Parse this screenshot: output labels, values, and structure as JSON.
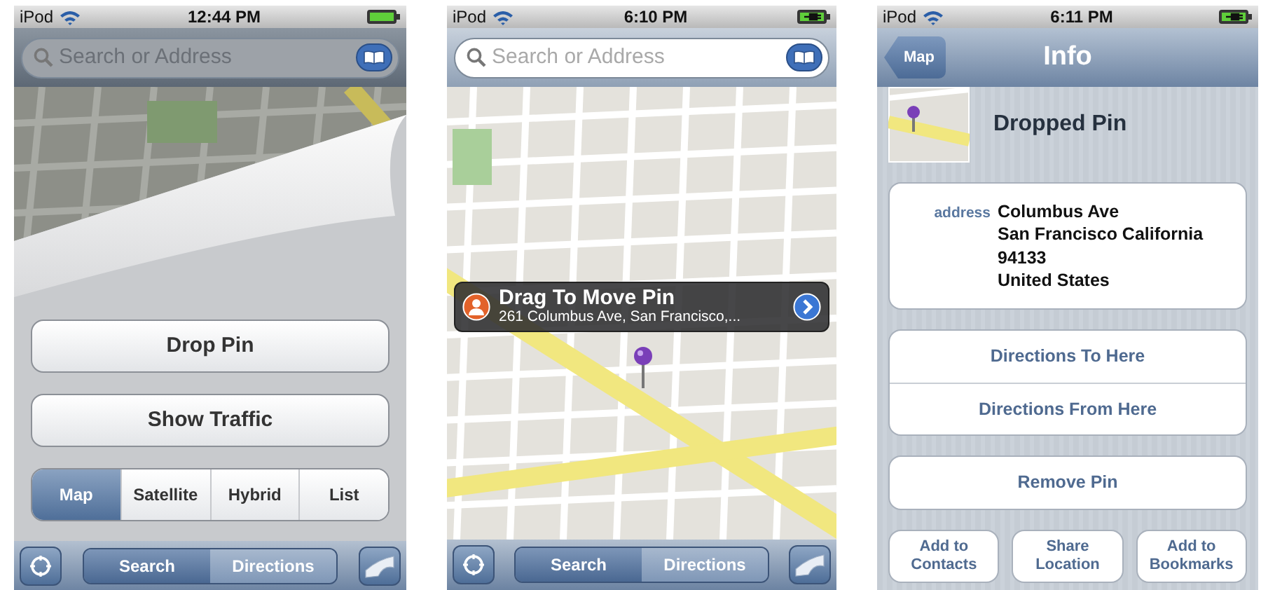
{
  "screens": [
    {
      "kind": "options",
      "status": {
        "carrier": "iPod",
        "time": "12:44 PM",
        "charging": false
      },
      "search": {
        "placeholder": "Search or Address"
      },
      "buttons": [
        "Drop Pin",
        "Show Traffic"
      ],
      "map_types": [
        {
          "label": "Map",
          "selected": true
        },
        {
          "label": "Satellite",
          "selected": false
        },
        {
          "label": "Hybrid",
          "selected": false
        },
        {
          "label": "List",
          "selected": false
        }
      ],
      "toolbar": [
        {
          "label": "Search",
          "selected": true
        },
        {
          "label": "Directions",
          "selected": false
        }
      ]
    },
    {
      "kind": "map",
      "status": {
        "carrier": "iPod",
        "time": "6:10 PM",
        "charging": true
      },
      "search": {
        "placeholder": "Search or Address"
      },
      "callout": {
        "title": "Drag To Move Pin",
        "subtitle": "261 Columbus Ave, San Francisco,..."
      },
      "toolbar": [
        {
          "label": "Search",
          "selected": true
        },
        {
          "label": "Directions",
          "selected": false
        }
      ]
    },
    {
      "kind": "info",
      "status": {
        "carrier": "iPod",
        "time": "6:11 PM",
        "charging": true
      },
      "nav": {
        "back": "Map",
        "title": "Info"
      },
      "name": "Dropped Pin",
      "address": {
        "label": "address",
        "lines": [
          "Columbus Ave",
          "San Francisco California",
          "94133",
          "United States"
        ]
      },
      "action_groups": [
        [
          "Directions To Here",
          "Directions From Here"
        ],
        [
          "Remove Pin"
        ]
      ],
      "bottom_buttons": [
        "Add to Contacts",
        "Share Location",
        "Add to Bookmarks"
      ]
    }
  ]
}
